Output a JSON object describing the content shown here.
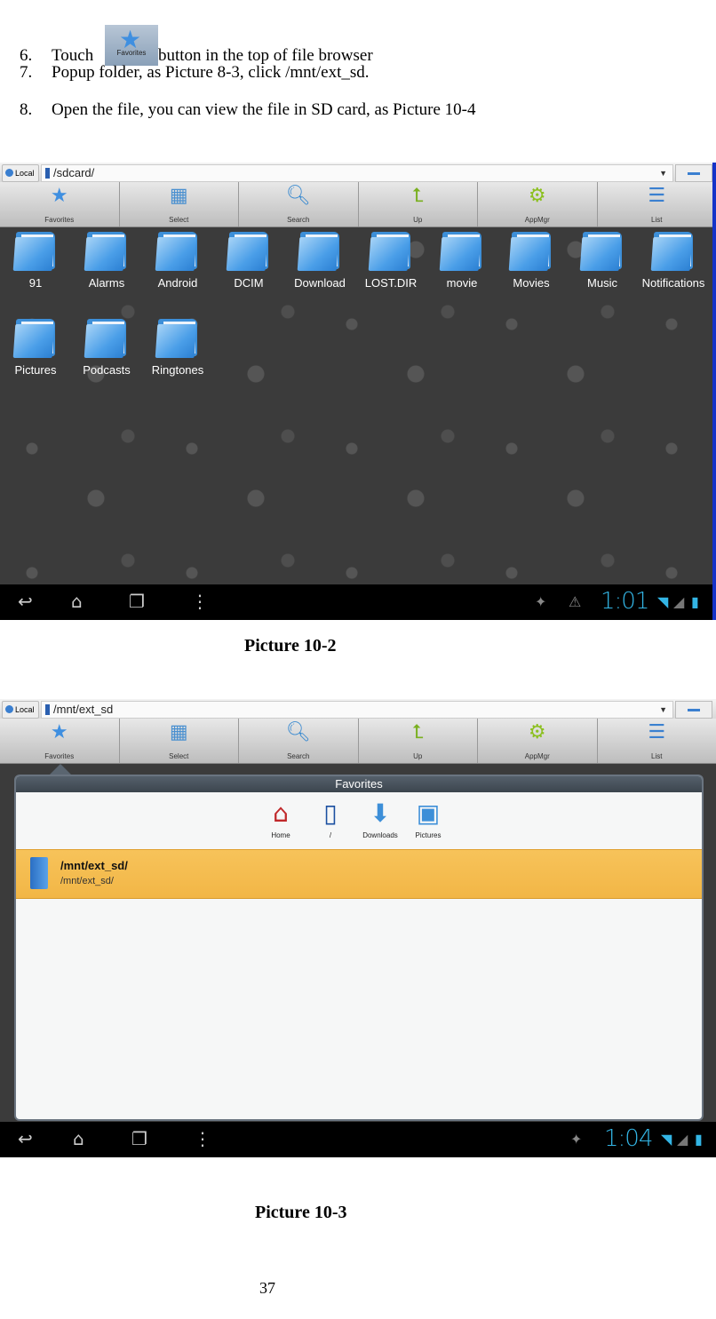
{
  "steps": [
    {
      "num": "6.",
      "before": "Touch",
      "inline_button_label": "Favorites",
      "after": "button in the top of file browser"
    },
    {
      "num": "7.",
      "text": "Popup folder, as Picture 8-3, click /mnt/ext_sd."
    },
    {
      "num": "8.",
      "text": "Open the file, you can view the file in SD card, as Picture 10-4"
    }
  ],
  "picture1": {
    "caption": "Picture 10-2",
    "location_button": "Local",
    "path": "/sdcard/",
    "toolbar": [
      "Favorites",
      "Select",
      "Search",
      "Up",
      "AppMgr",
      "List"
    ],
    "folders": [
      "91",
      "Alarms",
      "Android",
      "DCIM",
      "Download",
      "LOST.DIR",
      "movie",
      "Movies",
      "Music",
      "Notifications",
      "Pictures",
      "Podcasts",
      "Ringtones"
    ],
    "clock": "1:01"
  },
  "picture2": {
    "caption": "Picture 10-3",
    "location_button": "Local",
    "path": "/mnt/ext_sd",
    "toolbar": [
      "Favorites",
      "Select",
      "Search",
      "Up",
      "AppMgr",
      "List"
    ],
    "popup": {
      "title": "Favorites",
      "shortcuts": [
        "Home",
        "/",
        "Downloads",
        "Pictures"
      ],
      "selected_item": {
        "name": "/mnt/ext_sd/",
        "path": "/mnt/ext_sd/"
      }
    },
    "clock": "1:04"
  },
  "page_number": "37",
  "colors": {
    "accent_blue": "#33b5e5",
    "highlight": "#f2b646",
    "folder_blue": "#3d8fd8"
  }
}
